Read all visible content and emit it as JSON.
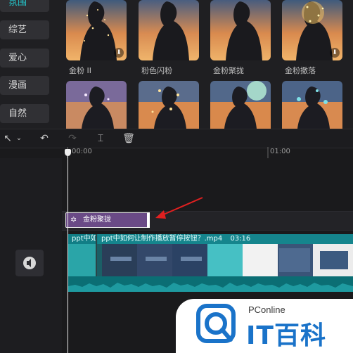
{
  "sidebar": {
    "items": [
      {
        "label": "氛围",
        "active": true
      },
      {
        "label": "综艺"
      },
      {
        "label": "爱心"
      },
      {
        "label": "漫画"
      },
      {
        "label": "自然"
      }
    ]
  },
  "effects": [
    {
      "label": "金粉 II",
      "downloadable": true
    },
    {
      "label": "粉色闪粉",
      "downloadable": false
    },
    {
      "label": "金粉聚拢",
      "downloadable": false
    },
    {
      "label": "金粉撒落",
      "downloadable": true
    },
    {
      "label": ""
    },
    {
      "label": ""
    },
    {
      "label": ""
    },
    {
      "label": ""
    }
  ],
  "toolbar": {
    "select_icon": "cursor-icon",
    "undo_icon": "undo-icon",
    "redo_icon": "redo-icon",
    "split_icon": "split-icon",
    "delete_icon": "delete-icon"
  },
  "ruler": {
    "start": "00:00",
    "mark": "01:00"
  },
  "effect_clip": {
    "label": "金粉聚拢",
    "color": "#6a4a86"
  },
  "video_track": {
    "clip1_title": "ppt中如何",
    "clip2_title": "ppt中如何让制作播放暂停按钮？.mp4",
    "clip2_duration": "03:16",
    "color": "#0c7f86"
  },
  "watermark": {
    "brand_small": "PConline",
    "brand_big": "IT百科",
    "color": "#1a73c9"
  }
}
